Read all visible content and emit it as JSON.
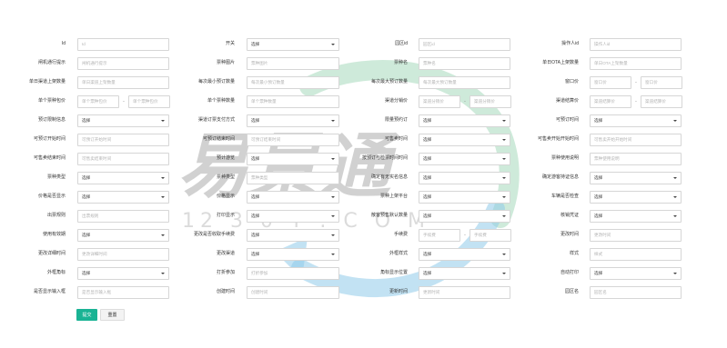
{
  "form": {
    "rows": [
      [
        {
          "label": "Id",
          "type": "input",
          "placeholder": "Id"
        },
        {
          "label": "开关",
          "type": "select",
          "value": "选择"
        },
        {
          "label": "园区id",
          "type": "input",
          "placeholder": "园区id"
        },
        {
          "label": "操作人id",
          "type": "input",
          "placeholder": "操作人id"
        }
      ],
      [
        {
          "label": "闸机通行提示",
          "type": "input",
          "placeholder": "闸机通行提示"
        },
        {
          "label": "票种图片",
          "type": "input",
          "placeholder": "票种图片"
        },
        {
          "label": "票种名",
          "type": "input",
          "placeholder": "票种名"
        },
        {
          "label": "单日OTA上架数量",
          "type": "input",
          "placeholder": "单日OTA上架数量"
        }
      ],
      [
        {
          "label": "单日渠道上架数量",
          "type": "input",
          "placeholder": "单日渠道上架数量"
        },
        {
          "label": "每次最小预订数量",
          "type": "input",
          "placeholder": "每次最小预订数量"
        },
        {
          "label": "每次最大预订数量",
          "type": "input",
          "placeholder": "每次最大预订数量"
        },
        {
          "label": "窗口价",
          "type": "range",
          "placeholder": "窗口价",
          "placeholder2": "窗口价"
        }
      ],
      [
        {
          "label": "单个票种包价",
          "type": "range",
          "placeholder": "单个票种包价",
          "placeholder2": "单个票种包价"
        },
        {
          "label": "单个票种数量",
          "type": "input",
          "placeholder": "单个票种数量"
        },
        {
          "label": "渠道分销价",
          "type": "range",
          "placeholder": "渠道分销价",
          "placeholder2": "渠道分销价"
        },
        {
          "label": "渠道结算价",
          "type": "range",
          "placeholder": "渠道结算价",
          "placeholder2": "渠道结算价"
        }
      ],
      [
        {
          "label": "预订限制信息",
          "type": "select",
          "value": "选择"
        },
        {
          "label": "渠道订票支付方式",
          "type": "select",
          "value": "选择"
        },
        {
          "label": "限量预约订",
          "type": "select",
          "value": "选择"
        },
        {
          "label": "可预订时间",
          "type": "select",
          "value": "选择"
        }
      ],
      [
        {
          "label": "可预订开始时间",
          "type": "input",
          "placeholder": "可预订开始时间"
        },
        {
          "label": "可预订结束时间",
          "type": "input",
          "placeholder": "可预订结束时间"
        },
        {
          "label": "可售卖时间",
          "type": "select",
          "value": "选择"
        },
        {
          "label": "可售卖开始开始时间",
          "type": "input",
          "placeholder": "可售卖开始开始时间"
        }
      ],
      [
        {
          "label": "可售卖结束时间",
          "type": "input",
          "placeholder": "可售卖结束时间"
        },
        {
          "label": "预计游览",
          "type": "select",
          "value": "选择"
        },
        {
          "label": "按预订与检票时间时间",
          "type": "select",
          "value": "选择"
        },
        {
          "label": "票种使用说明",
          "type": "input",
          "placeholder": "票种使用说明"
        }
      ],
      [
        {
          "label": "票种类型",
          "type": "select",
          "value": "选择"
        },
        {
          "label": "票种类型",
          "type": "input",
          "placeholder": "票种类型"
        },
        {
          "label": "确定有无实名信息",
          "type": "select",
          "value": "选择"
        },
        {
          "label": "确定游客持证信息",
          "type": "select",
          "value": "选择"
        }
      ],
      [
        {
          "label": "价格是否显示",
          "type": "select",
          "value": "选择"
        },
        {
          "label": "价格显示",
          "type": "select",
          "value": "选择"
        },
        {
          "label": "票种上架平台",
          "type": "select",
          "value": "选择"
        },
        {
          "label": "车辆是否检查",
          "type": "select",
          "value": "选择"
        }
      ],
      [
        {
          "label": "出票规则",
          "type": "input",
          "placeholder": "出票规则"
        },
        {
          "label": "打印显示",
          "type": "select",
          "value": "选择"
        },
        {
          "label": "散客预售默认数量",
          "type": "select",
          "value": "选择"
        },
        {
          "label": "核销凭证",
          "type": "select",
          "value": "选择"
        }
      ],
      [
        {
          "label": "使用有效期",
          "type": "select",
          "value": "选择"
        },
        {
          "label": "更改是否收取手续费",
          "type": "select",
          "value": "选择"
        },
        {
          "label": "手续费",
          "type": "range",
          "placeholder": "手续费",
          "placeholder2": "手续费"
        },
        {
          "label": "更改时间",
          "type": "input",
          "placeholder": "更改时间"
        }
      ],
      [
        {
          "label": "更改详细时间",
          "type": "input",
          "placeholder": "更改详细时间"
        },
        {
          "label": "更改渠道",
          "type": "select",
          "value": "选择"
        },
        {
          "label": "外框样式",
          "type": "select",
          "value": "选择"
        },
        {
          "label": "样式",
          "type": "input",
          "placeholder": "样式"
        }
      ],
      [
        {
          "label": "外框角标",
          "type": "select",
          "value": "选择"
        },
        {
          "label": "打折参加",
          "type": "input",
          "placeholder": "打折参加"
        },
        {
          "label": "角标显示位置",
          "type": "select",
          "value": "选择"
        },
        {
          "label": "自动打印",
          "type": "select",
          "value": "选择"
        }
      ],
      [
        {
          "label": "是否显示输入框",
          "type": "input",
          "placeholder": "是否显示输入框"
        },
        {
          "label": "创建时间",
          "type": "input",
          "placeholder": "创建时间"
        },
        {
          "label": "更新时间",
          "type": "input",
          "placeholder": "更新时间"
        },
        {
          "label": "园区名",
          "type": "input",
          "placeholder": "园区名"
        }
      ]
    ]
  },
  "buttons": {
    "submit": "提交",
    "reset": "重置"
  },
  "watermark": {
    "brand": "易景通",
    "site": "12 3 0 T . C O M",
    "colors": {
      "blue": "#5aaee0",
      "green": "#7ec6a0",
      "text": "#b8b8b8"
    }
  },
  "theme": {
    "accent": "#1ab394"
  }
}
